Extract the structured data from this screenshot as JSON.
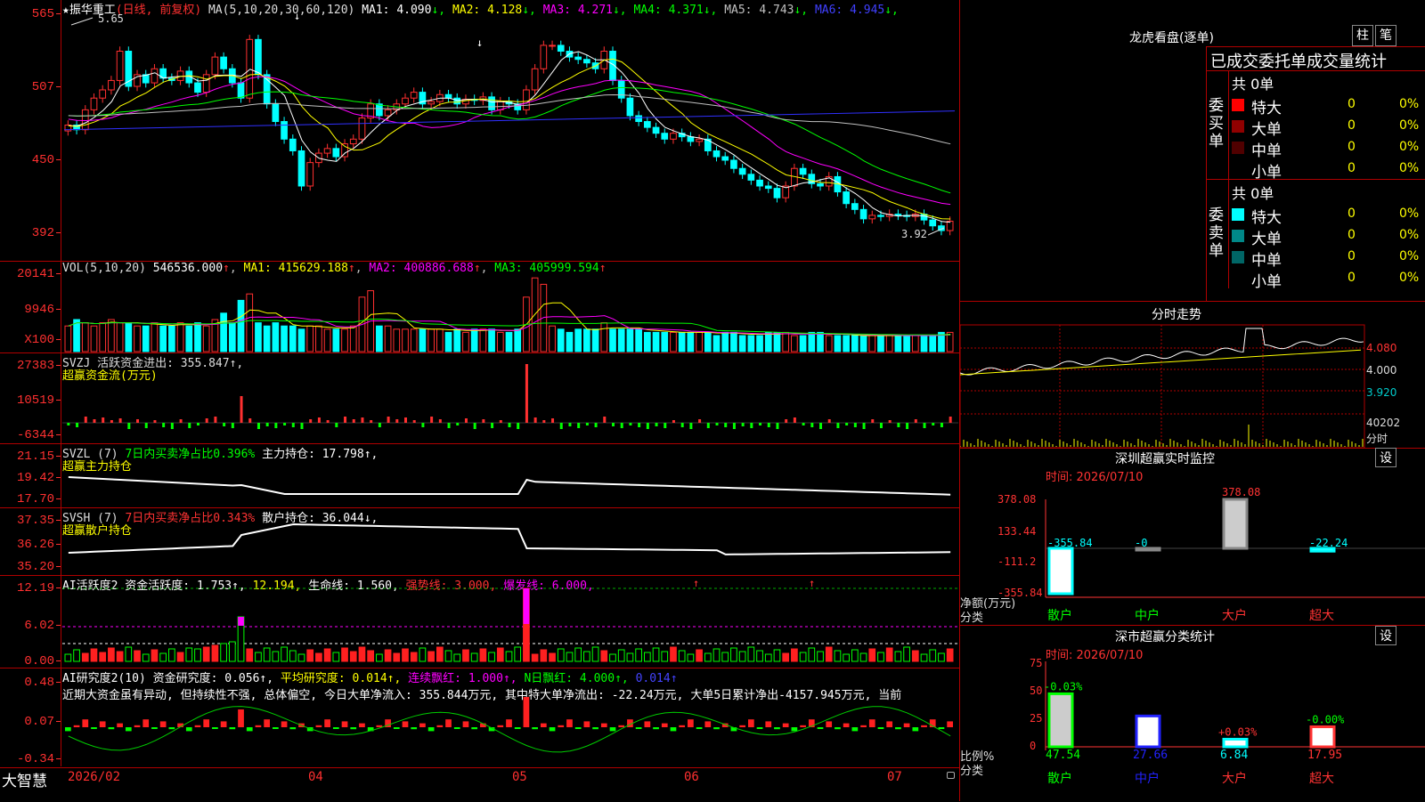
{
  "main_header": {
    "star": "★",
    "stock_name": "振华重工",
    "period": "(日线, 前复权)",
    "ma_def": "MA(5,10,20,30,60,120)",
    "items": [
      {
        "label": "MA1:",
        "value": "4.090",
        "arrow": "↓",
        "color": "#ffffff"
      },
      {
        "label": "MA2:",
        "value": "4.128",
        "arrow": "↓",
        "color": "#ffff00"
      },
      {
        "label": "MA3:",
        "value": "4.271",
        "arrow": "↓",
        "color": "#ff00ff"
      },
      {
        "label": "MA4:",
        "value": "4.371",
        "arrow": "↓",
        "color": "#00ff00"
      },
      {
        "label": "MA5:",
        "value": "4.743",
        "arrow": "↓",
        "color": "#c0c0c0"
      },
      {
        "label": "MA6:",
        "value": "4.945",
        "arrow": "↓",
        "color": "#4040ff"
      }
    ]
  },
  "main_axis": [
    "565",
    "507",
    "450",
    "392"
  ],
  "annotations": {
    "high": "5.65",
    "low": "3.92"
  },
  "vol_header": {
    "def": "VOL(5,10,20)",
    "vol": "546536.000",
    "ma1": "MA1: 415629.188",
    "ma2": "MA2: 400886.688",
    "ma3": "MA3: 405999.594",
    "arrow": "↑"
  },
  "vol_axis": [
    "20141",
    "9946",
    "X100"
  ],
  "svzj": {
    "line1": "SVZJ  活跃资金进出: 355.847↑,",
    "line2": "超赢资金流(万元)",
    "axis": [
      "27383",
      "10519",
      "-6344"
    ]
  },
  "svzl": {
    "def": "SVZL (7)",
    "ratio": "7日内买卖净占比0.396%",
    "hold": "主力持仓: 17.798↑,",
    "line2": "超赢主力持仓",
    "axis": [
      "21.15",
      "19.42",
      "17.70"
    ]
  },
  "svsh": {
    "def": "SVSH (7)",
    "ratio": "7日内买卖净占比0.343%",
    "hold": "散户持仓: 36.044↓,",
    "line2": "超赢散户持仓",
    "axis": [
      "37.35",
      "36.26",
      "35.20"
    ]
  },
  "ai1": {
    "a": "AI活跃度2 资金活跃度: 1.753↑,",
    "b": "12.194,",
    "c": "生命线: 1.560,",
    "d": "强势线: 3.000,",
    "e": "爆发线: 6.000,",
    "axis": [
      "12.19",
      "6.02",
      "0.00"
    ]
  },
  "ai2": {
    "a": "AI研究度2(10) 资金研究度: 0.056↑,",
    "b": "平均研究度: 0.014↑,",
    "c": "连续飘红: 1.000↑,",
    "d": "N日飘红: 4.000↑,",
    "e": "0.014↑",
    "comment": "近期大资金虽有异动, 但持续性不强, 总体偏空, 今日大单净流入: 355.844万元, 其中特大单净流出: -22.24万元, 大单5日累计净出-4157.945万元, 当前",
    "axis": [
      "0.48",
      "0.07",
      "-0.34"
    ]
  },
  "x_axis": {
    "brand": "大智慧",
    "labels": [
      "2026/02",
      "04",
      "05",
      "06",
      "07"
    ]
  },
  "right": {
    "longhu_title": "龙虎看盘(逐单)",
    "btn1": "柱",
    "btn2": "笔",
    "table_title": "已成交委托单成交量统计",
    "buy": {
      "side": "委买单",
      "total": "共 0单",
      "rows": [
        {
          "name": "特大",
          "v": "0",
          "p": "0%",
          "c": "#ff0000"
        },
        {
          "name": "大单",
          "v": "0",
          "p": "0%",
          "c": "#900000"
        },
        {
          "name": "中单",
          "v": "0",
          "p": "0%",
          "c": "#500000"
        },
        {
          "name": "小单",
          "v": "0",
          "p": "0%",
          "c": "#000000"
        }
      ]
    },
    "sell": {
      "side": "委卖单",
      "total": "共 0单",
      "rows": [
        {
          "name": "特大",
          "v": "0",
          "p": "0%",
          "c": "#00ffff"
        },
        {
          "name": "大单",
          "v": "0",
          "p": "0%",
          "c": "#008888"
        },
        {
          "name": "中单",
          "v": "0",
          "p": "0%",
          "c": "#006666"
        },
        {
          "name": "小单",
          "v": "0",
          "p": "0%",
          "c": "#000000"
        }
      ]
    },
    "fs_title": "分时走势",
    "fs_axis": [
      "4.080",
      "4.000",
      "3.920",
      "40202",
      "分时"
    ],
    "sz_title": "深圳超赢实时监控",
    "set1": "设",
    "sz_time": "时间: 2026/07/10",
    "sz_axis": [
      "378.08",
      "133.44",
      "-111.2",
      "-355.84"
    ],
    "sz_unit": "净额(万元)",
    "sz_cat": "分类",
    "sz_bars": [
      {
        "cat": "散户",
        "value": -355.84,
        "label": "-355.84"
      },
      {
        "cat": "中户",
        "value": 0,
        "label": "-0"
      },
      {
        "cat": "大户",
        "value": 378.08,
        "label": "378.08"
      },
      {
        "cat": "超大",
        "value": -22.24,
        "label": "-22.24"
      }
    ],
    "ss_title": "深市超赢分类统计",
    "set2": "设",
    "ss_time": "时间: 2026/07/10",
    "ss_axis": [
      "75",
      "50",
      "25",
      "0"
    ],
    "ss_unit": "比例%",
    "ss_cat": "分类",
    "ss_bars": [
      {
        "cat": "散户",
        "value": 47.54,
        "label": "47.54",
        "chg": "-0.03%"
      },
      {
        "cat": "中户",
        "value": 27.66,
        "label": "27.66",
        "chg": ""
      },
      {
        "cat": "大户",
        "value": 6.84,
        "label": "6.84",
        "chg": "+0.03%"
      },
      {
        "cat": "超大",
        "value": 17.95,
        "label": "17.95",
        "chg": "-0.00%"
      }
    ]
  },
  "chart_data": {
    "type": "bar",
    "title": "振华重工 (日线, 前复权)",
    "candles": [
      4.82,
      4.78,
      4.95,
      5.05,
      5.12,
      5.2,
      5.45,
      5.15,
      5.25,
      5.18,
      5.3,
      5.22,
      5.2,
      5.28,
      5.18,
      5.1,
      5.25,
      5.4,
      5.3,
      5.18,
      5.05,
      5.55,
      5.25,
      5.0,
      4.85,
      4.7,
      4.6,
      4.3,
      4.5,
      4.58,
      4.62,
      4.55,
      4.66,
      4.7,
      4.88,
      5.0,
      4.9,
      4.95,
      5.0,
      5.05,
      5.1,
      5.0,
      5.02,
      5.08,
      5.05,
      5.0,
      5.04,
      5.03,
      5.06,
      4.95,
      5.02,
      5.0,
      4.95,
      5.12,
      5.3,
      5.5,
      5.5,
      5.45,
      5.4,
      5.38,
      5.35,
      5.3,
      5.45,
      5.2,
      5.05,
      4.9,
      4.85,
      4.8,
      4.75,
      4.7,
      4.75,
      4.72,
      4.68,
      4.7,
      4.6,
      4.55,
      4.52,
      4.45,
      4.4,
      4.35,
      4.3,
      4.28,
      4.2,
      4.3,
      4.45,
      4.4,
      4.32,
      4.3,
      4.38,
      4.25,
      4.15,
      4.1,
      4.02,
      4.05,
      4.04,
      4.06,
      4.05,
      4.04,
      4.06,
      4.01,
      3.96,
      3.92,
      4.0
    ],
    "ylim": [
      3.7,
      5.75
    ],
    "series": [
      {
        "name": "MA1",
        "values": [
          4.09
        ]
      },
      {
        "name": "MA2",
        "values": [
          4.128
        ]
      },
      {
        "name": "MA3",
        "values": [
          4.271
        ]
      },
      {
        "name": "MA4",
        "values": [
          4.371
        ]
      },
      {
        "name": "MA5",
        "values": [
          4.743
        ]
      },
      {
        "name": "MA6",
        "values": [
          4.945
        ]
      }
    ],
    "volume": [
      8,
      10,
      9,
      8,
      9,
      10,
      9,
      9,
      8,
      8,
      9,
      8,
      8,
      9,
      8,
      9,
      8,
      10,
      12,
      9,
      16,
      18,
      9,
      8,
      9,
      8,
      8,
      7,
      8,
      8,
      7,
      7,
      7,
      8,
      17,
      19,
      8,
      8,
      7,
      7,
      7,
      7,
      7,
      7,
      6,
      7,
      6,
      7,
      7,
      7,
      6,
      6,
      7,
      17,
      23,
      21,
      8,
      7,
      6,
      7,
      7,
      7,
      9,
      7,
      7,
      7,
      7,
      6,
      6,
      6,
      6,
      6,
      6,
      6,
      6,
      5,
      6,
      6,
      5,
      5,
      5,
      6,
      6,
      6,
      5,
      5,
      6,
      6,
      5,
      5,
      5,
      5,
      5,
      5,
      5,
      5,
      5,
      5,
      5,
      5,
      5,
      6,
      6
    ]
  }
}
